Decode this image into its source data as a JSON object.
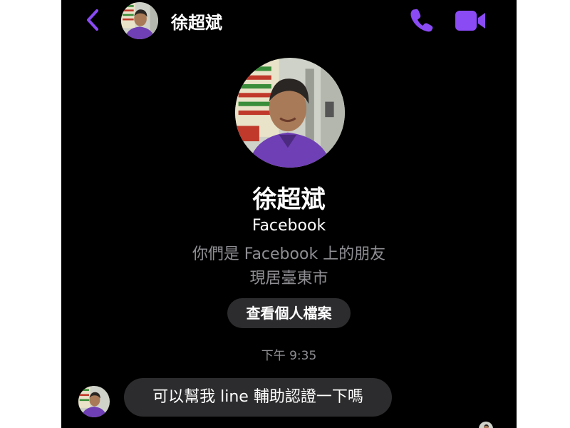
{
  "header": {
    "contact_name": "徐超斌",
    "back_icon": "chevron-left-icon",
    "call_icon": "phone-icon",
    "video_icon": "video-camera-icon"
  },
  "profile": {
    "name": "徐超斌",
    "platform": "Facebook",
    "friend_status": "你們是 Facebook 上的朋友",
    "location": "現居臺東市",
    "view_profile_label": "查看個人檔案"
  },
  "conversation": {
    "timestamp": "下午 9:35",
    "messages": [
      {
        "text": "可以幫我 line 輔助認證一下嗎"
      }
    ]
  },
  "colors": {
    "accent": "#8a4bf5",
    "background": "#000000",
    "bubble": "#2c2c2e",
    "secondary_text": "#8e8e93"
  }
}
